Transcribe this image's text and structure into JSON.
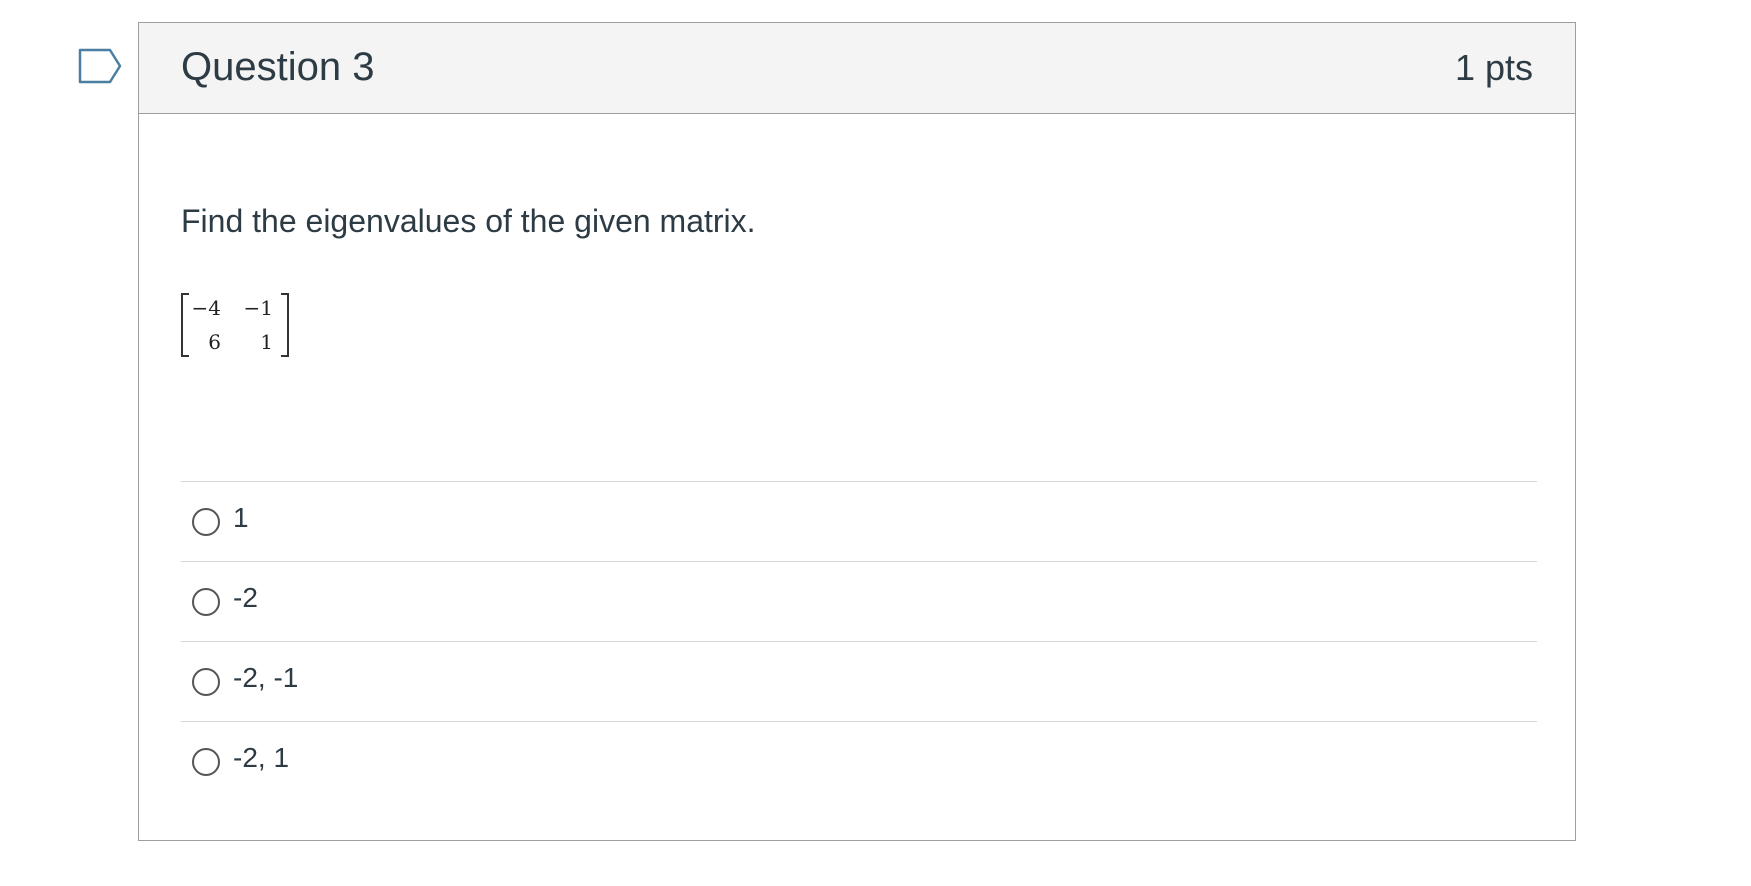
{
  "question": {
    "title": "Question 3",
    "points": "1 pts",
    "prompt": "Find the eigenvalues of the given matrix.",
    "matrix": {
      "r1c1": "−4",
      "r1c2": "−1",
      "r2c1": "6",
      "r2c2": "1"
    },
    "answers": [
      {
        "label": "1"
      },
      {
        "label": "-2"
      },
      {
        "label": "-2, -1"
      },
      {
        "label": "-2, 1"
      }
    ],
    "selected_answer": null
  },
  "colors": {
    "text": "#2d3b45",
    "header_bg": "#f4f4f4",
    "border": "#9e9e9e",
    "flag": "#4a7fa0"
  },
  "icons": {
    "flag": "bookmark-flag-icon"
  }
}
